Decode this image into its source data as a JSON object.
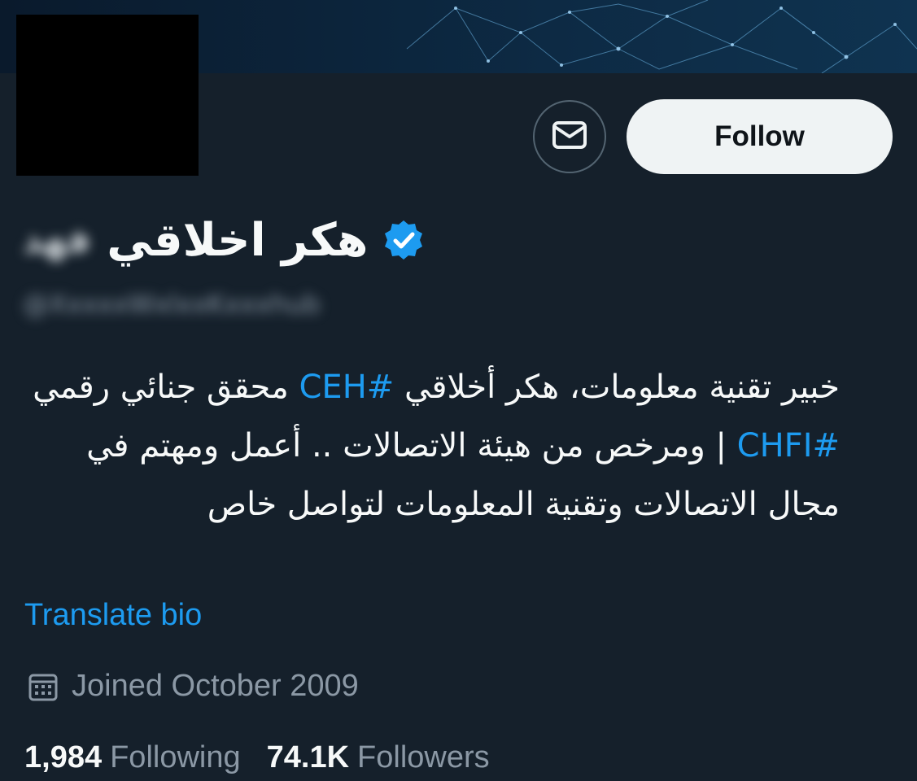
{
  "profile": {
    "display_name": "هكر اخلاقي",
    "name_suffix": "فهد",
    "handle": "@XxxxxWxlxxKxxxhub",
    "verified_icon": "verified-badge-icon",
    "avatar": "redacted"
  },
  "actions": {
    "message_icon": "envelope-icon",
    "follow_label": "Follow"
  },
  "bio": {
    "part1": "خبير تقنية معلومات، هكر أخلاقي ",
    "hashtag1": "#CEH",
    "part2": " محقق جنائي رقمي ",
    "hashtag2": "#CHFI",
    "part3": " | ومرخص من هيئة الاتصالات .. أعمل ومهتم في مجال الاتصالات وتقنية المعلومات لتواصل خاص",
    "translate_label": "Translate bio"
  },
  "joined": {
    "icon": "calendar-icon",
    "text": "Joined October 2009"
  },
  "stats": {
    "following_count": "1,984",
    "following_label": "Following",
    "followers_count": "74.1K",
    "followers_label": "Followers"
  },
  "colors": {
    "background": "#15202b",
    "accent": "#1d9bf0",
    "secondary_text": "#8b98a5",
    "follow_bg": "#eff3f4"
  }
}
